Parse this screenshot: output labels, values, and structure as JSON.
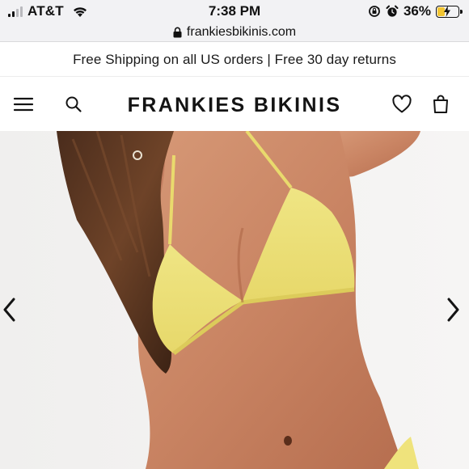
{
  "status_bar": {
    "carrier": "AT&T",
    "time": "7:38 PM",
    "battery": "36%",
    "battery_level": 0.36,
    "icons": [
      "signal-bars-icon",
      "wifi-icon",
      "orientation-lock-icon",
      "alarm-icon",
      "battery-charging-icon"
    ]
  },
  "browser": {
    "url": "frankiesbikinis.com",
    "icons": [
      "lock-icon"
    ]
  },
  "announcement": {
    "text": "Free Shipping on all US orders | Free 30 day returns"
  },
  "header": {
    "brand": "FRANKIES BIKINIS",
    "icons": [
      "hamburger-menu-icon",
      "search-icon",
      "heart-icon",
      "shopping-bag-icon"
    ]
  },
  "hero": {
    "description_icons": [
      "chevron-left-icon",
      "chevron-right-icon"
    ]
  },
  "colors": {
    "browser_chrome": "#f2f2f4",
    "bikini_yellow": "#efe37c",
    "battery_yellow": "#f2c531",
    "text_dark": "#141414"
  }
}
